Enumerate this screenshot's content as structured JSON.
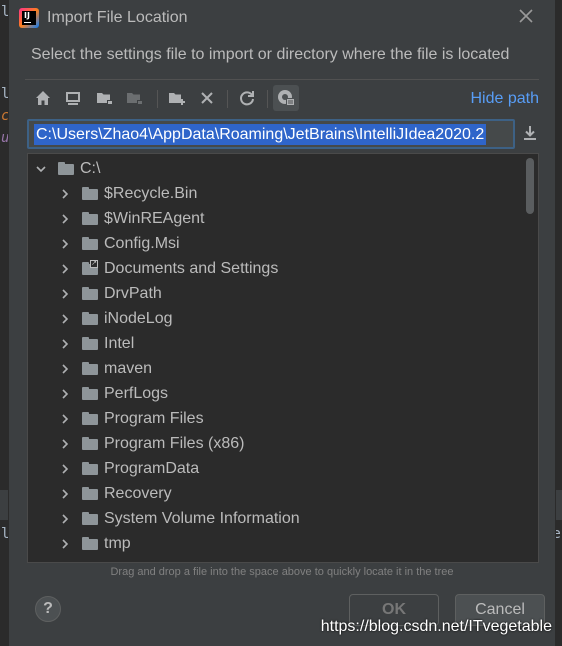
{
  "background": {
    "edge_chars": [
      "l",
      "c",
      "u",
      "l",
      "l"
    ],
    "right_edge_chars": [
      "t",
      "te"
    ]
  },
  "dialog": {
    "title": "Import File Location",
    "prompt": "Select the settings file to import or directory where the file is located",
    "hide_path_label": "Hide path",
    "path_value": "C:\\Users\\Zhao4\\AppData\\Roaming\\JetBrains\\IntelliJIdea2020.2",
    "hint": "Drag and drop a file into the space above to quickly locate it in the tree",
    "help_label": "?",
    "ok_label": "OK",
    "cancel_label": "Cancel"
  },
  "toolbar": {
    "icons": [
      "home-icon",
      "desktop-icon",
      "project-folder-icon",
      "module-folder-icon",
      "new-folder-icon",
      "delete-icon",
      "refresh-icon",
      "show-hidden-icon"
    ]
  },
  "tree": {
    "root": "C:\\",
    "items": [
      {
        "label": "$Recycle.Bin"
      },
      {
        "label": "$WinREAgent"
      },
      {
        "label": "Config.Msi"
      },
      {
        "label": "Documents and Settings",
        "link": true
      },
      {
        "label": "DrvPath"
      },
      {
        "label": "iNodeLog"
      },
      {
        "label": "Intel"
      },
      {
        "label": "maven"
      },
      {
        "label": "PerfLogs"
      },
      {
        "label": "Program Files"
      },
      {
        "label": "Program Files (x86)"
      },
      {
        "label": "ProgramData"
      },
      {
        "label": "Recovery"
      },
      {
        "label": "System Volume Information"
      },
      {
        "label": "tmp"
      }
    ]
  },
  "watermark": "https://blog.csdn.net/ITvegetable",
  "colors": {
    "dialog_bg": "#3c3f41",
    "tree_bg": "#2b2b2b",
    "accent_link": "#589df6",
    "selection": "#2f65ca",
    "text": "#bbbbbb"
  }
}
